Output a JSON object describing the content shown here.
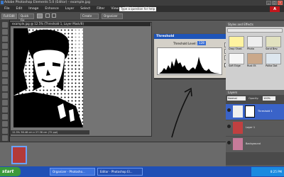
{
  "app": {
    "title": "Adobe Photoshop Elements 5.0 (Editor) - example.jpg",
    "window_buttons": [
      "_",
      "□",
      "x"
    ]
  },
  "menu": {
    "items": [
      "File",
      "Edit",
      "Image",
      "Enhance",
      "Layer",
      "Select",
      "Filter",
      "View",
      "Window",
      "Help"
    ],
    "help_search_placeholder": "Type a question for help"
  },
  "options_bar": {
    "full_edit_label": "Full Edit",
    "quick_fix_label": "Quick Fix",
    "create_label": "Create",
    "organizer_label": "Organizer"
  },
  "document": {
    "title": "example.jpg @ 12.5% (Threshold 1, Layer Mask/8)",
    "status": "12.5%   36.48 cm x 27.36 cm (72 ppi)"
  },
  "threshold_dialog": {
    "title": "Threshold",
    "level_label": "Threshold Level:",
    "level_value": "128",
    "ok_label": "OK",
    "cancel_label": "Cancel",
    "help_label": "Help",
    "preview_label": "Preview",
    "preview_checked": true
  },
  "palette": {
    "title": "Styles and Effects",
    "items": [
      "Drop Shad.",
      "Photo",
      "Sand Bev.",
      "Soft Edge",
      "Rust Ef.",
      "Polka Dot"
    ]
  },
  "layers": {
    "title": "Layers",
    "blend_mode": "Normal",
    "opacity_label": "Opacity:",
    "opacity_value": "100%",
    "items": [
      {
        "name": "Threshold 1",
        "selected": true
      },
      {
        "name": "Layer 1",
        "selected": false
      },
      {
        "name": "Background",
        "selected": false
      }
    ]
  },
  "taskbar": {
    "start_label": "start",
    "tasks": [
      "Organizer - Photosho...",
      "Editor - Photoshop El..."
    ],
    "clock": "8:25 PM"
  },
  "colors": {
    "accent": "#1e54b8",
    "selected_layer": "#3a63c8",
    "taskbar": "#1f4fb5"
  }
}
